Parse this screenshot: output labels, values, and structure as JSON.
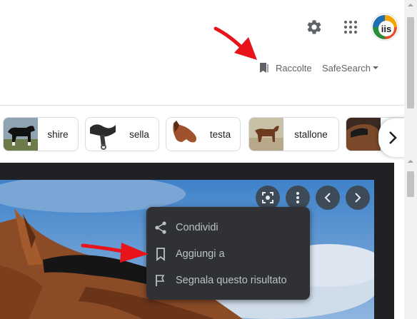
{
  "header": {
    "settings_icon": "gear-icon",
    "apps_icon": "apps-grid-icon",
    "avatar_text": "iis",
    "collections_label": "Raccolte",
    "safesearch_label": "SafeSearch"
  },
  "chips": [
    {
      "label": "shire",
      "thumb": "horse-shire-thumb"
    },
    {
      "label": "sella",
      "thumb": "saddle-thumb"
    },
    {
      "label": "testa",
      "thumb": "horse-head-thumb"
    },
    {
      "label": "stallone",
      "thumb": "stallion-thumb"
    },
    {
      "label": "",
      "thumb": "horse-thumb"
    }
  ],
  "viewer": {
    "lens_icon": "lens-icon",
    "more_icon": "more-vert-icon",
    "prev_icon": "chevron-left-icon",
    "next_icon": "chevron-right-icon"
  },
  "menu": {
    "items": [
      {
        "label": "Condividi",
        "icon": "share-icon"
      },
      {
        "label": "Aggiungi a",
        "icon": "bookmark-icon"
      },
      {
        "label": "Segnala questo risultato",
        "icon": "flag-icon"
      }
    ]
  },
  "colors": {
    "annotation_arrow": "#e8131b",
    "menu_bg": "#303134",
    "viewer_bg": "#202124",
    "menu_text": "#bdc1c6"
  }
}
